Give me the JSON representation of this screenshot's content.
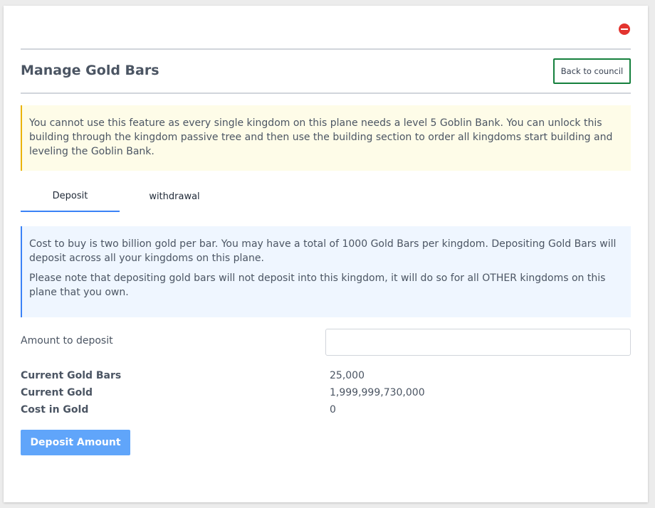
{
  "header": {
    "title": "Manage Gold Bars",
    "back_label": "Back to council",
    "close_icon": "minus-circle-icon",
    "close_color": "#e3342f"
  },
  "warning": {
    "text": "You cannot use this feature as every single kingdom on this plane needs a level 5 Goblin Bank. You can unlock this building through the kingdom passive tree and then use the building section to order all kingdoms start building and leveling the Goblin Bank."
  },
  "tabs": [
    {
      "label": "Deposit",
      "active": true
    },
    {
      "label": "withdrawal",
      "active": false
    }
  ],
  "info": {
    "paragraph1": "Cost to buy is two billion gold per bar. You may have a total of 1000 Gold Bars per kingdom. Depositing Gold Bars will deposit across all your kingdoms on this plane.",
    "paragraph2": "Please note that depositing gold bars will not deposit into this kingdom, it will do so for all OTHER kingdoms on this plane that you own."
  },
  "form": {
    "amount_label": "Amount to deposit",
    "amount_value": "",
    "amount_placeholder": ""
  },
  "stats": [
    {
      "label": "Current Gold Bars",
      "value": "25,000"
    },
    {
      "label": "Current Gold",
      "value": "1,999,999,730,000"
    },
    {
      "label": "Cost in Gold",
      "value": "0"
    }
  ],
  "actions": {
    "deposit_label": "Deposit Amount"
  },
  "colors": {
    "primary": "#60a5fa",
    "success_border": "#15803d",
    "warning_border": "#eab308",
    "info_border": "#3b82f6"
  }
}
